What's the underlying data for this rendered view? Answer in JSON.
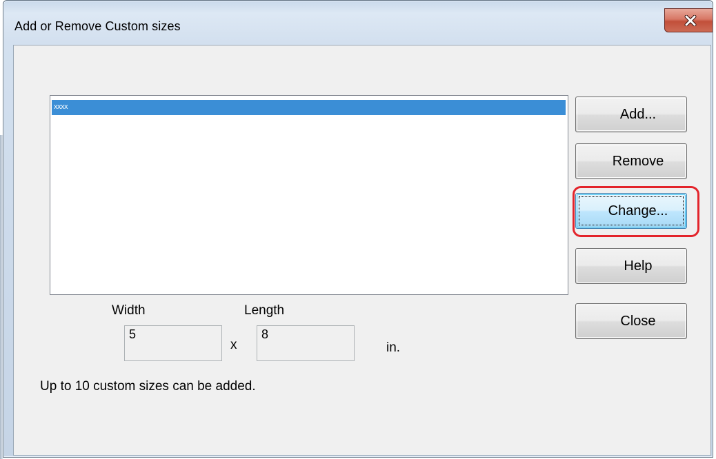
{
  "window": {
    "title": "Add or Remove Custom sizes",
    "close_icon": "close-x-icon"
  },
  "list": {
    "items": [
      {
        "label": "xxxx",
        "selected": true
      }
    ]
  },
  "buttons": {
    "add": "Add...",
    "remove": "Remove",
    "change": "Change...",
    "help": "Help",
    "close": "Close"
  },
  "size": {
    "width_label": "Width",
    "length_label": "Length",
    "width_value": "5",
    "length_value": "8",
    "separator": "x",
    "unit": "in."
  },
  "note": "Up to 10 custom sizes can be added.",
  "colors": {
    "selection": "#3b8ed6",
    "highlight": "#e3242b",
    "close_button": "#c24f3a"
  }
}
